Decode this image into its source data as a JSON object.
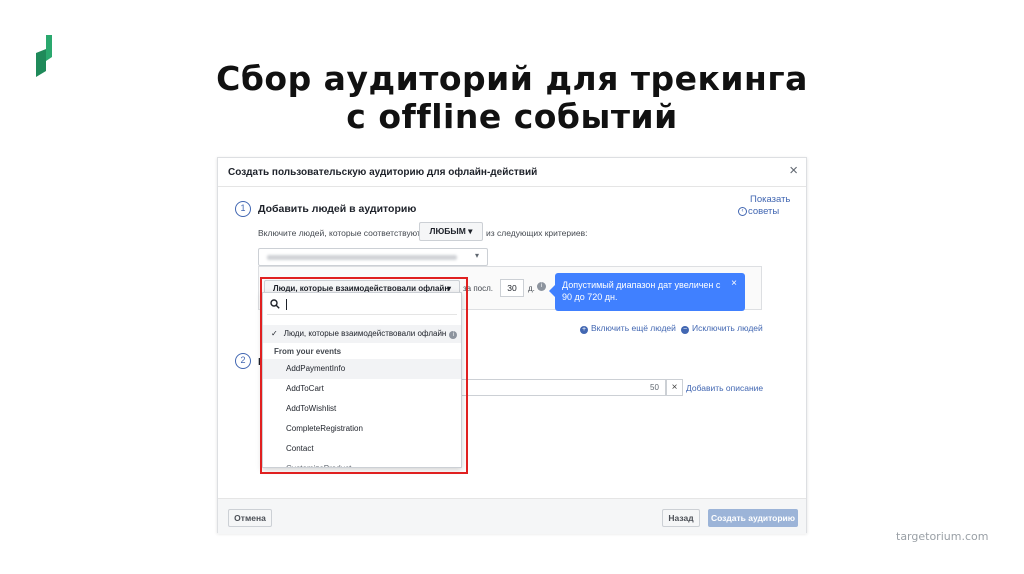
{
  "slide": {
    "title_line1": "Сбор аудиторий для трекинга",
    "title_line2": "с offline событий",
    "footer": "targetorium.com",
    "logo_color": "#1f8a5a"
  },
  "dialog": {
    "title": "Создать пользовательскую аудиторию для офлайн-действий",
    "close": "×",
    "tips_line1": "Показать",
    "tips_line2": "советы",
    "step1": {
      "number": "1",
      "title": "Добавить людей в аудиторию",
      "include_prefix": "Включите людей, которые соответствуют",
      "match_value": "ЛЮБЫМ",
      "include_suffix": "из следующих критериев:",
      "rule": {
        "event_label": "Люди, которые взаимодействовали офлайн",
        "last_label": "за посл.",
        "days_value": "30",
        "days_unit": "д."
      },
      "tooltip": {
        "text": "Допустимый диапазон дат увеличен с 90 до 720 дн.",
        "close": "×",
        "color": "#4080ff"
      },
      "include_more": "Включить ещё людей",
      "exclude": "Исключить людей"
    },
    "step2": {
      "number": "2",
      "title_letter": "Н",
      "char_count": "50",
      "clear": "×",
      "add_description": "Добавить описание"
    },
    "footer": {
      "cancel": "Отмена",
      "back": "Назад",
      "create": "Создать аудиторию"
    }
  },
  "dropdown": {
    "selected": "Люди, которые взаимодействовали офлайн",
    "section": "From your events",
    "items": [
      "AddPaymentInfo",
      "AddToCart",
      "AddToWishlist",
      "CompleteRegistration",
      "Contact",
      "CustomizeProduct"
    ],
    "highlight_color": "#e02020"
  }
}
